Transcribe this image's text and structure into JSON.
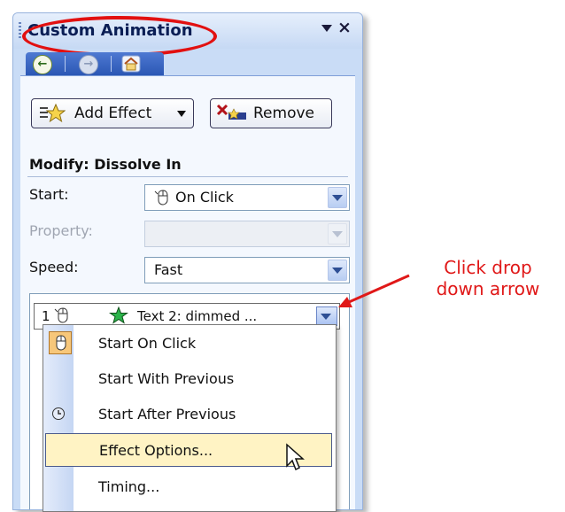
{
  "pane": {
    "title": "Custom Animation",
    "nav": {
      "back": "back-icon",
      "forward": "forward-icon",
      "home": "home-icon"
    },
    "close_symbol": "×"
  },
  "toolbar": {
    "add_effect_label": "Add Effect",
    "remove_label": "Remove"
  },
  "modify": {
    "heading": "Modify: Dissolve In",
    "start_label": "Start:",
    "start_value": "On Click",
    "property_label": "Property:",
    "property_value": "",
    "speed_label": "Speed:",
    "speed_value": "Fast"
  },
  "effect_list": {
    "items": [
      {
        "index": "1",
        "text": "Text 2: dimmed ..."
      }
    ]
  },
  "context_menu": {
    "items": [
      {
        "label": "Start On Click",
        "icon": "mouse-icon",
        "highlighted": false
      },
      {
        "label": "Start With Previous",
        "icon": "",
        "highlighted": false
      },
      {
        "label": "Start After Previous",
        "icon": "clock-icon",
        "highlighted": false
      },
      {
        "label": "Effect Options...",
        "icon": "",
        "highlighted": true
      },
      {
        "label": "Timing...",
        "icon": "",
        "highlighted": false
      }
    ]
  },
  "annotation": {
    "line1": "Click drop",
    "line2": "down arrow",
    "color": "#e01818"
  },
  "colors": {
    "highlight_ring": "#e21010",
    "menu_highlight": "#fff3c4",
    "pane_background": "#c9dcf6"
  }
}
